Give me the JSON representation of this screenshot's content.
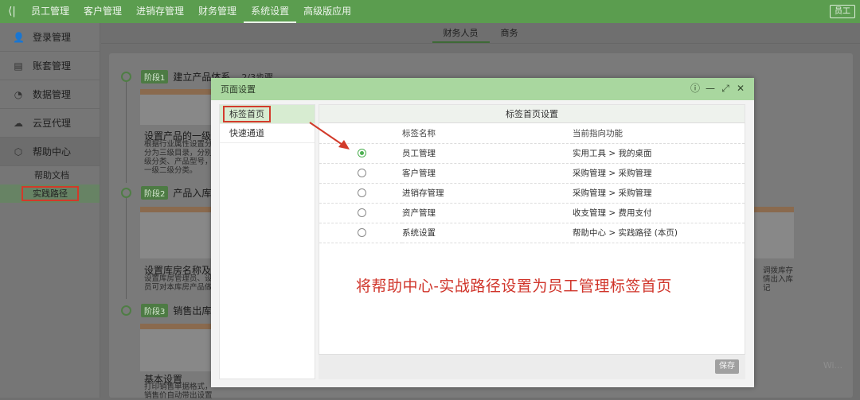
{
  "colors": {
    "brand_green": "#5b9d4f",
    "modal_header": "#a9d79f",
    "highlight_red": "#d23a2a",
    "radio_checked": "#4caf50"
  },
  "topbar": {
    "back_icon": "chevron-left-icon",
    "nav": [
      "员工管理",
      "客户管理",
      "进销存管理",
      "财务管理",
      "系统设置",
      "高级版应用"
    ],
    "active_nav": "系统设置",
    "user_button": "员工"
  },
  "sidebar": {
    "items": [
      {
        "label": "登录管理",
        "icon": "user-icon"
      },
      {
        "label": "账套管理",
        "icon": "ledger-icon"
      },
      {
        "label": "数据管理",
        "icon": "pie-chart-icon"
      },
      {
        "label": "云豆代理",
        "icon": "cloud-icon"
      },
      {
        "label": "帮助中心",
        "icon": "help-cube-icon"
      }
    ],
    "subitems": [
      "帮助文档",
      "实践路径"
    ],
    "active_subitem": "实践路径"
  },
  "content_tabs": [
    "财务人员",
    "商务"
  ],
  "background": {
    "stages": [
      {
        "badge": "阶段1",
        "title": "建立产品体系",
        "steps": "2/3步骤"
      },
      {
        "badge": "阶段2",
        "title": "产品入库"
      },
      {
        "badge": "阶段3",
        "title": "销售出库"
      }
    ],
    "cards": [
      {
        "title": "设置产品的一级工",
        "desc": "根据行业属性设置分分为三级目录，分别级分类、产品型号，一级二级分类。"
      },
      {
        "title": "设置库房名称及库",
        "desc": "设置库房管理员、设员可对本库房产品做"
      },
      {
        "title": "基本设置",
        "desc": "打印销售单据格式，销售价自动带出设置"
      }
    ],
    "right_card_desc": "调拨库存情出入库记",
    "watermark": "Wi..."
  },
  "modal": {
    "title": "页面设置",
    "controls": [
      "help-icon",
      "minimize-icon",
      "maximize-icon",
      "close-icon"
    ],
    "side_items": [
      "标签首页",
      "快速通道"
    ],
    "active_side_item": "标签首页",
    "main_header": "标签首页设置",
    "columns": [
      "标签名称",
      "当前指向功能"
    ],
    "rows": [
      {
        "name": "员工管理",
        "target": "实用工具 > 我的桌面",
        "checked": true
      },
      {
        "name": "客户管理",
        "target": "采购管理 > 采购管理",
        "checked": false
      },
      {
        "name": "进销存管理",
        "target": "采购管理 > 采购管理",
        "checked": false
      },
      {
        "name": "资产管理",
        "target": "收支管理 > 费用支付",
        "checked": false
      },
      {
        "name": "系统设置",
        "target": "帮助中心 > 实践路径 (本页)",
        "checked": false
      }
    ],
    "save_label": "保存"
  },
  "annotation": "将帮助中心-实战路径设置为员工管理标签首页"
}
